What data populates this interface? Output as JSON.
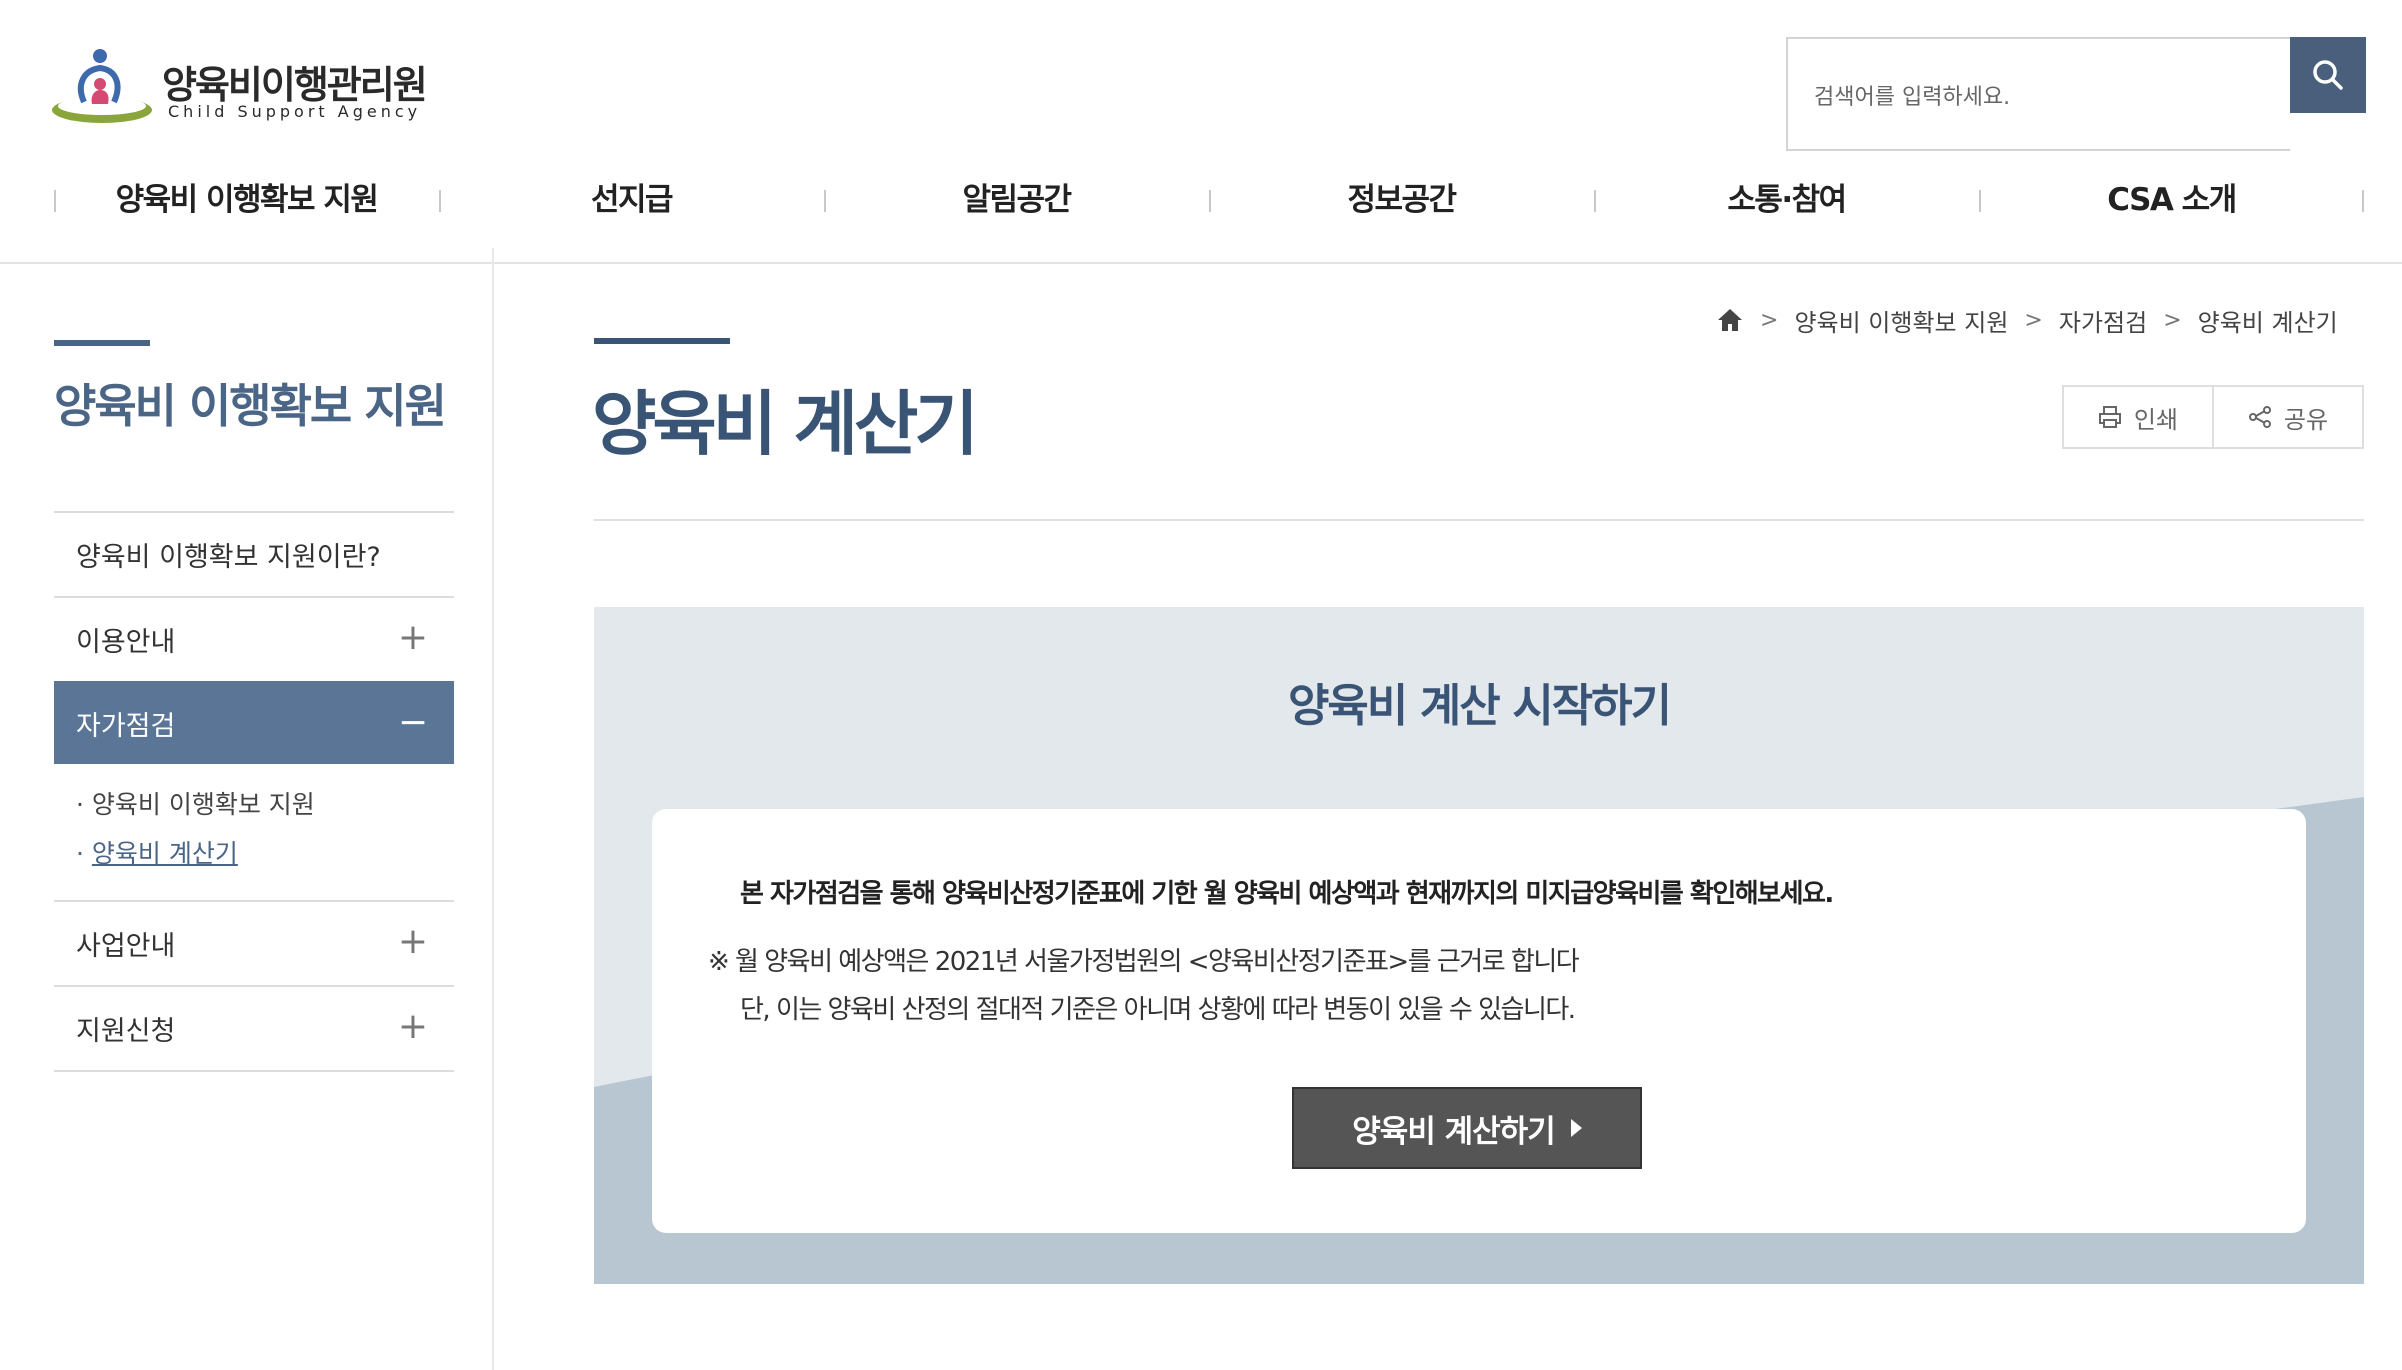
{
  "header": {
    "logo": {
      "title": "양육비이행관리원",
      "subtitle": "Child Support Agency"
    },
    "search": {
      "placeholder": "검색어를 입력하세요.",
      "button_icon": "search-icon"
    }
  },
  "gnb": {
    "items": [
      {
        "label": "양육비 이행확보 지원"
      },
      {
        "label": "선지급"
      },
      {
        "label": "알림공간"
      },
      {
        "label": "정보공간"
      },
      {
        "label": "소통·참여"
      },
      {
        "label": "CSA 소개"
      }
    ]
  },
  "lnb": {
    "title": "양육비 이행확보 지원",
    "items": [
      {
        "label": "양육비 이행확보 지원이란?",
        "sign": ""
      },
      {
        "label": "이용안내",
        "sign": "+"
      },
      {
        "label": "자가점검",
        "sign": "−",
        "active": true
      },
      {
        "label": "사업안내",
        "sign": "+"
      },
      {
        "label": "지원신청",
        "sign": "+"
      }
    ],
    "sub_items": [
      {
        "bullet": "·",
        "label": "양육비 이행확보 지원"
      },
      {
        "bullet": "·",
        "label": "양육비 계산기",
        "current": true
      }
    ]
  },
  "breadcrumb": {
    "home_icon": "home-icon",
    "items": [
      "양육비 이행확보 지원",
      "자가점검",
      "양육비 계산기"
    ],
    "separator": ">"
  },
  "page": {
    "title": "양육비 계산기"
  },
  "utility": {
    "print_label": "인쇄",
    "share_label": "공유"
  },
  "calculator": {
    "title": "양육비 계산 시작하기",
    "lead": "본 자가점검을 통해 양육비산정기준표에 기한 월 양육비 예상액과 현재까지의 미지급양육비를 확인해보세요.",
    "note_line1": "※ 월 양육비 예상액은 2021년 서울가정법원의 <양육비산정기준표>를 근거로 합니다",
    "note_line2": "단, 이는 양육비 산정의 절대적 기준은 아니며 상황에 따라 변동이 있을 수 있습니다.",
    "button_label": "양육비 계산하기"
  },
  "colors": {
    "primary": "#3a5476",
    "lnb_active": "#5b7597",
    "search_button": "#4a5f7c",
    "panel_bg": "#e3e8ed",
    "panel_wave": "#b7c6d1",
    "calc_button": "#555555"
  }
}
